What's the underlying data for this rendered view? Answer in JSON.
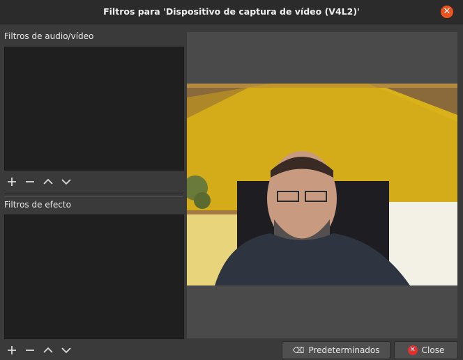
{
  "window": {
    "title": "Filtros para 'Dispositivo de captura de vídeo (V4L2)'"
  },
  "audio_video_filters": {
    "label": "Filtros de audio/vídeo"
  },
  "effect_filters": {
    "label": "Filtros de efecto"
  },
  "toolbar_icons": [
    "plus-icon",
    "minus-icon",
    "chevron-up-icon",
    "chevron-down-icon"
  ],
  "buttons": {
    "defaults_label": "Predeterminados",
    "close_label": "Close"
  },
  "colors": {
    "accent": "#e95420",
    "close_red": "#e03030"
  }
}
